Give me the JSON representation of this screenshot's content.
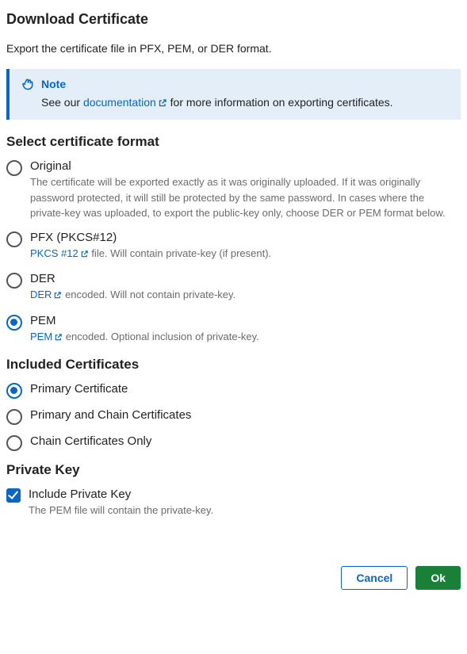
{
  "title": "Download Certificate",
  "lead": "Export the certificate file in PFX, PEM, or DER format.",
  "note": {
    "label": "Note",
    "body_prefix": "See our ",
    "link_text": "documentation",
    "body_suffix": " for more information on exporting certificates."
  },
  "format_section": {
    "title": "Select certificate format",
    "options": [
      {
        "label": "Original",
        "desc_plain": "The certificate will be exported exactly as it was originally uploaded. If it was originally password protected, it will still be protected by the same password. In cases where the private-key was uploaded, to export the public-key only, choose DER or PEM format below.",
        "checked": false,
        "link": null
      },
      {
        "label": "PFX (PKCS#12)",
        "link": "PKCS #12",
        "desc_after_link": " file. Will contain private-key (if present).",
        "checked": false
      },
      {
        "label": "DER",
        "link": "DER",
        "desc_after_link": " encoded. Will not contain private-key.",
        "checked": false
      },
      {
        "label": "PEM",
        "link": "PEM",
        "desc_after_link": " encoded. Optional inclusion of private-key.",
        "checked": true
      }
    ]
  },
  "included_section": {
    "title": "Included Certificates",
    "options": [
      {
        "label": "Primary Certificate",
        "checked": true
      },
      {
        "label": "Primary and Chain Certificates",
        "checked": false
      },
      {
        "label": "Chain Certificates Only",
        "checked": false
      }
    ]
  },
  "private_key_section": {
    "title": "Private Key",
    "label": "Include Private Key",
    "desc": "The PEM file will contain the private-key.",
    "checked": true
  },
  "buttons": {
    "cancel": "Cancel",
    "ok": "Ok"
  }
}
